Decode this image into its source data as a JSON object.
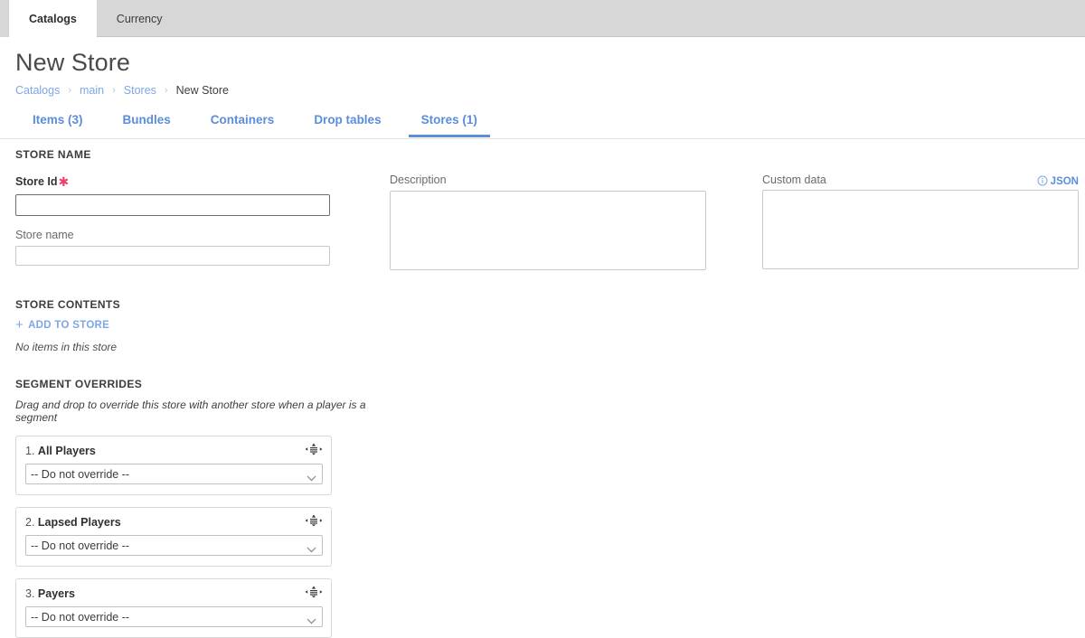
{
  "window": {
    "tabs": [
      {
        "label": "Catalogs",
        "active": true
      },
      {
        "label": "Currency",
        "active": false
      }
    ]
  },
  "header": {
    "title": "New Store",
    "breadcrumb": [
      {
        "label": "Catalogs",
        "current": false
      },
      {
        "label": "main",
        "current": false
      },
      {
        "label": "Stores",
        "current": false
      },
      {
        "label": "New Store",
        "current": true
      }
    ],
    "breadcrumb_separator": "›"
  },
  "section_tabs": [
    {
      "label": "Items (3)",
      "active": false
    },
    {
      "label": "Bundles",
      "active": false
    },
    {
      "label": "Containers",
      "active": false
    },
    {
      "label": "Drop tables",
      "active": false
    },
    {
      "label": "Stores (1)",
      "active": true
    }
  ],
  "store_name_section": {
    "heading": "STORE NAME",
    "store_id": {
      "label": "Store Id",
      "required_marker": "✱",
      "value": "",
      "placeholder": ""
    },
    "store_name": {
      "label": "Store name",
      "value": "",
      "placeholder": ""
    },
    "description": {
      "label": "Description",
      "value": "",
      "placeholder": ""
    },
    "custom_data": {
      "label": "Custom data",
      "json_link": "JSON",
      "info_icon": "info-circle-icon",
      "value": "",
      "placeholder": ""
    }
  },
  "store_contents_section": {
    "heading": "STORE CONTENTS",
    "add_label": "ADD TO STORE",
    "add_icon": "plus-icon",
    "empty_message": "No items in this store"
  },
  "segment_overrides_section": {
    "heading": "SEGMENT OVERRIDES",
    "hint": "Drag and drop to override this store with another store when a player is a segment",
    "drag_icon": "drag-handle-icon",
    "chevron_icon": "chevron-down-icon",
    "cards": [
      {
        "index": "1.",
        "name": "All Players",
        "selected": "-- Do not override --"
      },
      {
        "index": "2.",
        "name": "Lapsed Players",
        "selected": "-- Do not override --"
      },
      {
        "index": "3.",
        "name": "Payers",
        "selected": "-- Do not override --"
      }
    ],
    "select_options": [
      "-- Do not override --"
    ]
  },
  "colors": {
    "accent_blue": "#5b8ddd",
    "link_blue": "#7ea6e8",
    "required_pink": "#e8436f",
    "topbar_gray": "#d7d7d7"
  }
}
